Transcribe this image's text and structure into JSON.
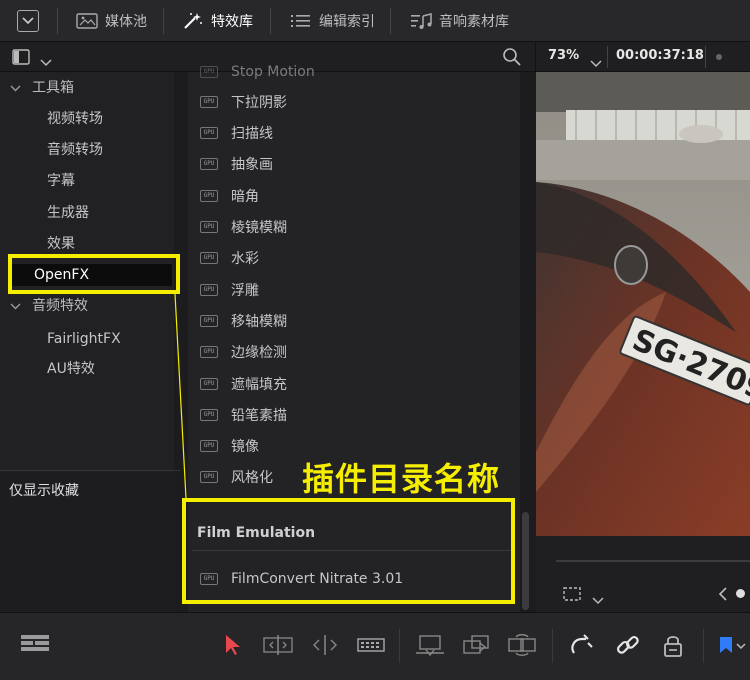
{
  "topbar": {
    "media_pool": "媒体池",
    "effects_library": "特效库",
    "edit_index": "编辑索引",
    "sound_library": "音响素材库"
  },
  "subbar": {
    "zoom": "73%",
    "timecode": "00:00:37:18"
  },
  "tree": {
    "toolbox": "工具箱",
    "video_transitions": "视频转场",
    "audio_transitions": "音频转场",
    "titles": "字幕",
    "generators": "生成器",
    "effects": "效果",
    "openfx": "OpenFX",
    "audio_fx": "音频特效",
    "fairlightfx": "FairlightFX",
    "au_fx": "AU特效",
    "favorites_only": "仅显示收藏"
  },
  "effects_list": {
    "items": [
      "Stop Motion",
      "下拉阴影",
      "扫描线",
      "抽象画",
      "暗角",
      "棱镜模糊",
      "水彩",
      "浮雕",
      "移轴模糊",
      "边缘检测",
      "遮幅填充",
      "铅笔素描",
      "镜像",
      "风格化"
    ],
    "gpu_badge": "GPU",
    "category_header": "Film Emulation",
    "category_items": [
      "FilmConvert Nitrate 3.01"
    ]
  },
  "annotation": {
    "text": "插件目录名称"
  },
  "colors": {
    "highlight": "#f5ee00",
    "selected_bg": "#0c0c0d",
    "arrow_red": "#e8484d",
    "marker_blue": "#2f7cf6"
  },
  "icons": [
    "dropdown-square-icon",
    "media-pool-icon",
    "effects-wand-icon",
    "list-icon",
    "sound-library-icon",
    "panel-layout-icon",
    "search-icon",
    "chevron-down-icon",
    "gpu-icon",
    "select-arrow-icon",
    "trim-icon",
    "dynamic-trim-icon",
    "blade-icon",
    "insert-icon",
    "overwrite-icon",
    "replace-icon",
    "snapping-icon",
    "link-icon",
    "lock-icon",
    "flag-icon"
  ]
}
